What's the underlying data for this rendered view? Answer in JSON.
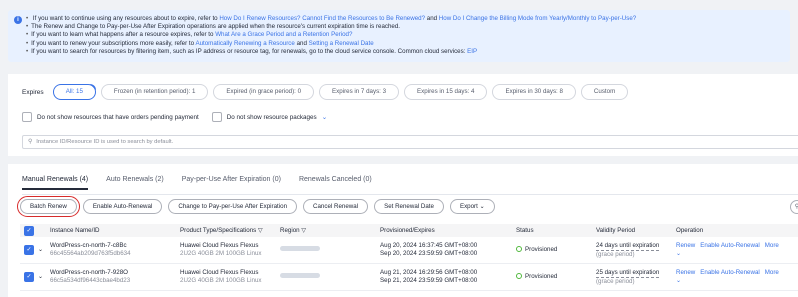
{
  "notice": {
    "lines": [
      {
        "parts": [
          "If you want to continue using any resources about to expire, refer to ",
          "How Do I Renew Resources?",
          " ",
          "Cannot Find the Resources to Be Renewed?",
          " and ",
          "How Do I Change the Billing Mode from Yearly/Monthly to Pay-per-Use?"
        ]
      },
      {
        "parts": [
          "The Renew and Change to Pay-per-Use After Expiration operations are applied when the resource's current expiration time is reached."
        ]
      },
      {
        "parts": [
          "If you want to learn what happens after a resource expires, refer to ",
          "What Are a Grace Period and a Retention Period?"
        ]
      },
      {
        "parts": [
          "If you want to renew your subscriptions more easily, refer to ",
          "Automatically Renewing a Resource",
          " and ",
          "Setting a Renewal Date"
        ]
      },
      {
        "parts": [
          "If you want to search for resources by filtering item, such as IP address or resource tag, for renewals, go to the cloud service console. Common cloud services: ",
          "EIP"
        ]
      }
    ]
  },
  "filters": {
    "expires_label": "Expires",
    "tags": [
      "All: 15",
      "Frozen (in retention period): 1",
      "Expired (in grace period): 0",
      "Expires in 7 days: 3",
      "Expires in 15 days: 4",
      "Expires in 30 days: 8",
      "Custom"
    ],
    "check_pending": "Do not show resources that have orders pending payment",
    "check_packages": "Do not show resource packages",
    "search_placeholder": "Instance ID/Resource ID is used to search by default."
  },
  "tabs": [
    "Manual Renewals (4)",
    "Auto Renewals (2)",
    "Pay-per-Use After Expiration (0)",
    "Renewals Canceled (0)"
  ],
  "toolbar": [
    "Batch Renew",
    "Enable Auto-Renewal",
    "Change to Pay-per-Use After Expiration",
    "Cancel Renewal",
    "Set Renewal Date",
    "Export"
  ],
  "columns": [
    "Instance Name/ID",
    "Product Type/Specifications",
    "Region",
    "Provisioned/Expires",
    "Status",
    "Validity Period",
    "Operation"
  ],
  "rows": [
    {
      "name": "WordPress-cn-north-7-c8Bc",
      "id": "66c45564ab209d763f5db634",
      "product": "Huawei Cloud Flexus Flexus",
      "spec": "2U2G 40GB 2M 100GB Linux",
      "provisioned": "Aug 20, 2024 16:37:45 GMT+08:00",
      "expires": "Sep 20, 2024 23:59:59 GMT+08:00",
      "status": "Provisioned",
      "validity": "24 days until expiration",
      "validity_note": "(grace period)",
      "ops": [
        "Renew",
        "Enable Auto-Renewal",
        "More"
      ]
    },
    {
      "name": "WordPress-cn-north-7-928O",
      "id": "66c5a534df96443cbae4bd23",
      "product": "Huawei Cloud Flexus Flexus",
      "spec": "2U2G 40GB 2M 100GB Linux",
      "provisioned": "Aug 21, 2024 16:29:56 GMT+08:00",
      "expires": "Sep 21, 2024 23:59:59 GMT+08:00",
      "status": "Provisioned",
      "validity": "25 days until expiration",
      "validity_note": "(grace period)",
      "ops": [
        "Renew",
        "Enable Auto-Renewal",
        "More"
      ]
    }
  ]
}
